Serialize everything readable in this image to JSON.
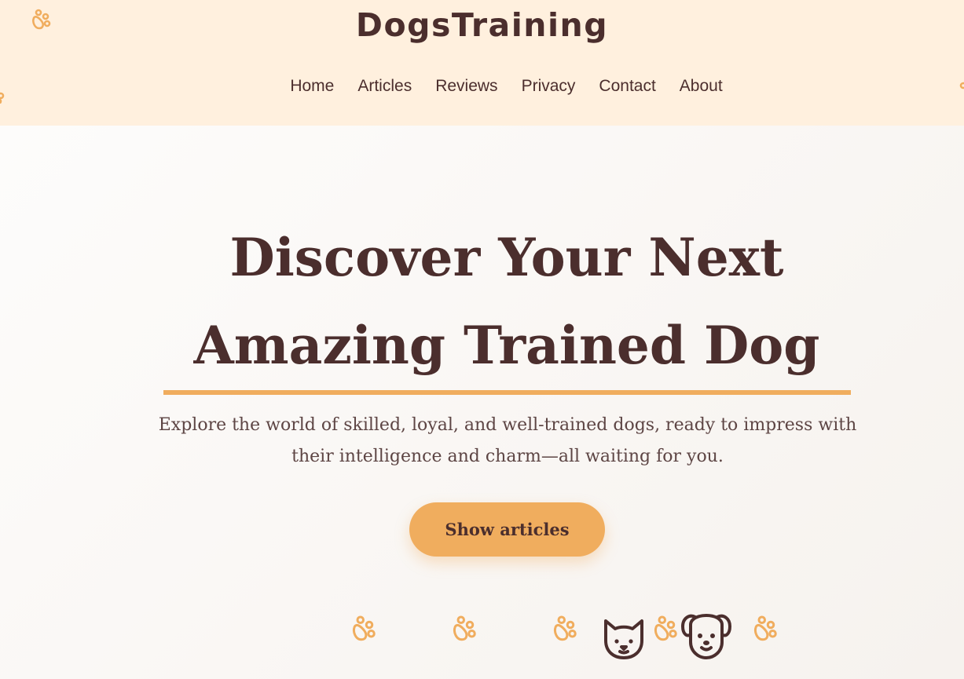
{
  "header": {
    "brand": "DogsTraining",
    "nav": [
      "Home",
      "Articles",
      "Reviews",
      "Privacy",
      "Contact",
      "About"
    ]
  },
  "hero": {
    "title": "Discover Your Next Amazing Trained Dog",
    "subtitle": "Explore the world of skilled, loyal, and well-trained dogs, ready to impress with their intelligence and charm—all waiting for you.",
    "cta_label": "Show articles"
  },
  "icons": {
    "paw": "paw-print-icon",
    "cat": "cat-face-icon",
    "dog": "dog-face-icon"
  },
  "colors": {
    "header_bg": "#fff0de",
    "text_dark": "#4b2e2d",
    "accent": "#f0ad5e",
    "page_bg": "#fbf9f7"
  }
}
